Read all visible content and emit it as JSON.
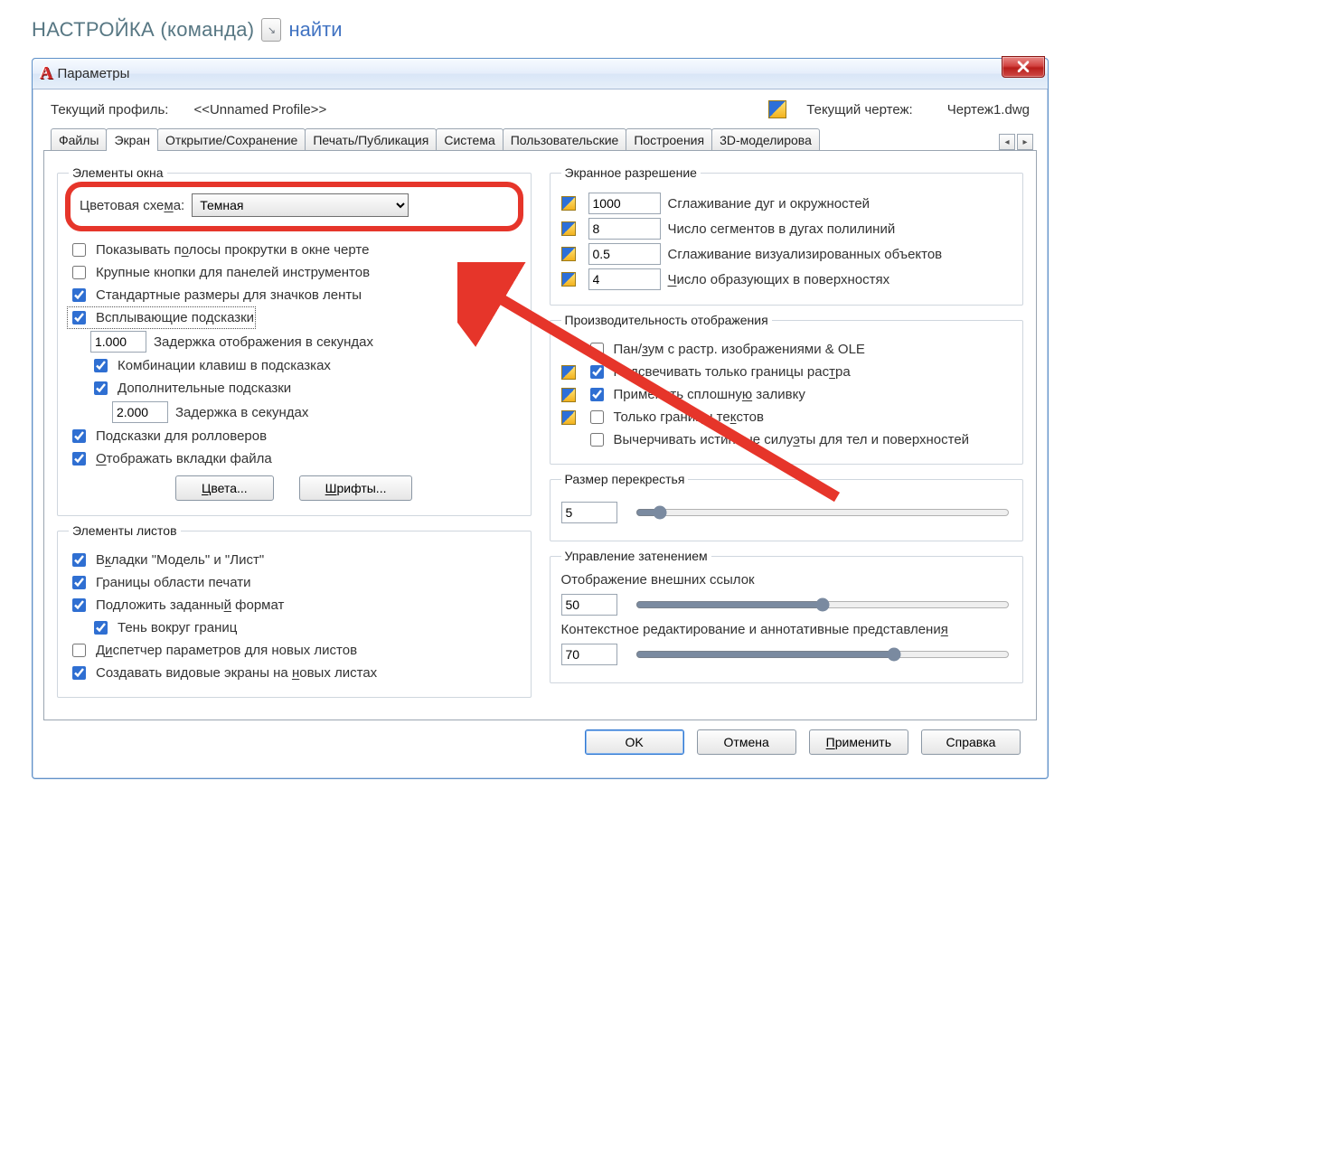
{
  "page": {
    "title": "НАСТРОЙКА (команда)",
    "find_label": "найти"
  },
  "dialog": {
    "title": "Параметры",
    "close_tooltip": "Close"
  },
  "profile": {
    "label": "Текущий профиль:",
    "value": "<<Unnamed Profile>>",
    "drawing_label": "Текущий чертеж:",
    "drawing_value": "Чертеж1.dwg"
  },
  "tabs": [
    "Файлы",
    "Экран",
    "Открытие/Сохранение",
    "Печать/Публикация",
    "Система",
    "Пользовательские",
    "Построения",
    "3D-моделирова"
  ],
  "active_tab_index": 1,
  "window_elements": {
    "legend": "Элементы окна",
    "color_scheme_label": "Цветовая схема:",
    "color_scheme_value": "Темная",
    "chk_scrollbars": "Показывать полосы прокрутки в окне черте",
    "chk_largebtns": "Крупные кнопки для панелей инструментов",
    "chk_ribbonstd": "Стандартные размеры для значков ленты",
    "chk_tooltips": "Всплывающие подсказки",
    "delay1_value": "1.000",
    "delay1_label": "Задержка отображения в секундах",
    "chk_shortcuts": "Комбинации клавиш в подсказках",
    "chk_extended": "Дополнительные подсказки",
    "delay2_value": "2.000",
    "delay2_label": "Задержка в секундах",
    "chk_rollover": "Подсказки для ролловеров",
    "chk_filetabs": "Отображать вкладки файла",
    "btn_colors": "Цвета...",
    "btn_fonts": "Шрифты..."
  },
  "layout_elements": {
    "legend": "Элементы листов",
    "chk_modeltabs": "Вкладки \"Модель\" и \"Лист\"",
    "chk_printarea": "Границы области печати",
    "chk_paper": "Подложить заданный формат",
    "chk_shadow": "Тень вокруг границ",
    "chk_dispmgr": "Диспетчер параметров для новых листов",
    "chk_viewports": "Создавать видовые экраны на новых листах"
  },
  "resolution": {
    "legend": "Экранное разрешение",
    "r1_value": "1000",
    "r1_label": "Сглаживание дуг и окружностей",
    "r2_value": "8",
    "r2_label": "Число сегментов в дугах полилиний",
    "r3_value": "0.5",
    "r3_label": "Сглаживание визуализированных объектов",
    "r4_value": "4",
    "r4_label": "Число образующих в поверхностях"
  },
  "performance": {
    "legend": "Производительность отображения",
    "chk_panzoom": "Пан/зум с растр. изображениями & OLE",
    "chk_raster": "Подсвечивать только границы растра",
    "chk_solidfill": "Применить сплошную заливку",
    "chk_textbound": "Только границы текстов",
    "chk_truesil": "Вычерчивать истинные силуэты для тел и поверхностей"
  },
  "crosshair": {
    "legend": "Размер перекрестья",
    "value": "5"
  },
  "fade": {
    "legend": "Управление затенением",
    "xref_label": "Отображение внешних ссылок",
    "xref_value": "50",
    "inplace_label": "Контекстное редактирование и аннотативные представления",
    "inplace_value": "70"
  },
  "footer": {
    "ok": "OK",
    "cancel": "Отмена",
    "apply": "Применить",
    "help": "Справка"
  }
}
